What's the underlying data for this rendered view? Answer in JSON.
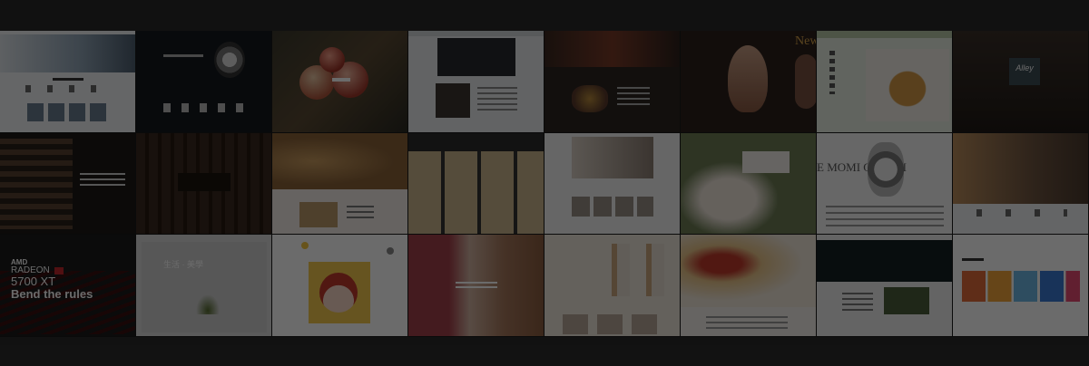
{
  "gallery": {
    "amd_thumb": {
      "brand": "AMD",
      "product_line": "RADEON",
      "model": "5700 XT",
      "headline": "Bend the rules"
    },
    "fashion_thumb": {
      "brand_text": "New"
    },
    "watch_thumb": {
      "band_text": "E MOMI   OREVEI"
    },
    "cafe_thumb": {
      "sign_text": "Alley"
    },
    "photo_thumb": {
      "title_text": "生活 · 美學"
    }
  }
}
